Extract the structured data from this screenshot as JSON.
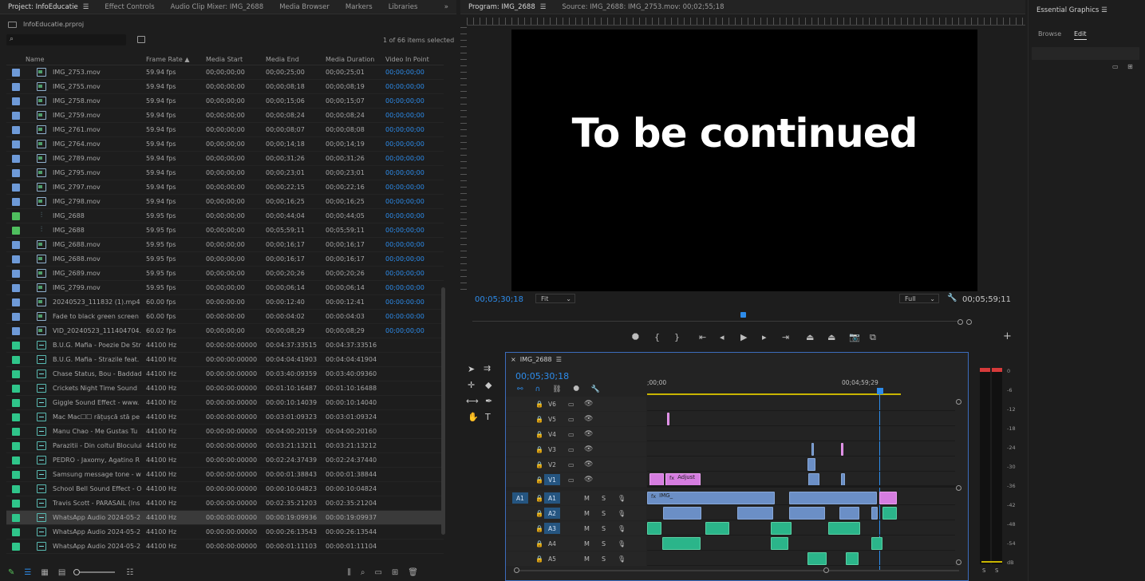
{
  "project_tabs": [
    {
      "label": "Project: InfoEducatie",
      "active": true
    },
    {
      "label": "Effect Controls"
    },
    {
      "label": "Audio Clip Mixer: IMG_2688"
    },
    {
      "label": "Media Browser"
    },
    {
      "label": "Markers"
    },
    {
      "label": "Libraries"
    }
  ],
  "project_file": "InfoEducatie.prproj",
  "search_placeholder": "",
  "items_selected": "1 of 66 items selected",
  "columns": [
    "Name",
    "Frame Rate",
    "Media Start",
    "Media End",
    "Media Duration",
    "Video In Point"
  ],
  "rows": [
    {
      "name": "IMG_2753.mov",
      "fr": "59.94 fps",
      "start": "00;00;00;00",
      "end": "00;00;25;00",
      "dur": "00;00;25;01",
      "vin": "00;00;00;00",
      "color": "#6e9ad8",
      "kind": "video"
    },
    {
      "name": "IMG_2755.mov",
      "fr": "59.94 fps",
      "start": "00;00;00;00",
      "end": "00;00;08;18",
      "dur": "00;00;08;19",
      "vin": "00;00;00;00",
      "color": "#6e9ad8",
      "kind": "video"
    },
    {
      "name": "IMG_2758.mov",
      "fr": "59.94 fps",
      "start": "00;00;00;00",
      "end": "00;00;15;06",
      "dur": "00;00;15;07",
      "vin": "00;00;00;00",
      "color": "#6e9ad8",
      "kind": "video"
    },
    {
      "name": "IMG_2759.mov",
      "fr": "59.94 fps",
      "start": "00;00;00;00",
      "end": "00;00;08;24",
      "dur": "00;00;08;24",
      "vin": "00;00;00;00",
      "color": "#6e9ad8",
      "kind": "video"
    },
    {
      "name": "IMG_2761.mov",
      "fr": "59.94 fps",
      "start": "00;00;00;00",
      "end": "00;00;08;07",
      "dur": "00;00;08;08",
      "vin": "00;00;00;00",
      "color": "#6e9ad8",
      "kind": "video"
    },
    {
      "name": "IMG_2764.mov",
      "fr": "59.94 fps",
      "start": "00;00;00;00",
      "end": "00;00;14;18",
      "dur": "00;00;14;19",
      "vin": "00;00;00;00",
      "color": "#6e9ad8",
      "kind": "video"
    },
    {
      "name": "IMG_2789.mov",
      "fr": "59.94 fps",
      "start": "00;00;00;00",
      "end": "00;00;31;26",
      "dur": "00;00;31;26",
      "vin": "00;00;00;00",
      "color": "#6e9ad8",
      "kind": "video"
    },
    {
      "name": "IMG_2795.mov",
      "fr": "59.94 fps",
      "start": "00;00;00;00",
      "end": "00;00;23;01",
      "dur": "00;00;23;01",
      "vin": "00;00;00;00",
      "color": "#6e9ad8",
      "kind": "video"
    },
    {
      "name": "IMG_2797.mov",
      "fr": "59.94 fps",
      "start": "00;00;00;00",
      "end": "00;00;22;15",
      "dur": "00;00;22;16",
      "vin": "00;00;00;00",
      "color": "#6e9ad8",
      "kind": "video"
    },
    {
      "name": "IMG_2798.mov",
      "fr": "59.94 fps",
      "start": "00;00;00;00",
      "end": "00;00;16;25",
      "dur": "00;00;16;25",
      "vin": "00;00;00;00",
      "color": "#6e9ad8",
      "kind": "video"
    },
    {
      "name": "IMG_2688",
      "fr": "59.95 fps",
      "start": "00;00;00;00",
      "end": "00;00;44;04",
      "dur": "00;00;44;05",
      "vin": "00;00;00;00",
      "color": "#4fbf5e",
      "kind": "seq"
    },
    {
      "name": "IMG_2688",
      "fr": "59.95 fps",
      "start": "00;00;00;00",
      "end": "00;05;59;11",
      "dur": "00;05;59;11",
      "vin": "00;00;00;00",
      "color": "#4fbf5e",
      "kind": "seq"
    },
    {
      "name": "IMG_2688.mov",
      "fr": "59.95 fps",
      "start": "00;00;00;00",
      "end": "00;00;16;17",
      "dur": "00;00;16;17",
      "vin": "00;00;00;00",
      "color": "#6e9ad8",
      "kind": "video"
    },
    {
      "name": "IMG_2688.mov",
      "fr": "59.95 fps",
      "start": "00;00;00;00",
      "end": "00;00;16;17",
      "dur": "00;00;16;17",
      "vin": "00;00;00;00",
      "color": "#6e9ad8",
      "kind": "video"
    },
    {
      "name": "IMG_2689.mov",
      "fr": "59.95 fps",
      "start": "00;00;00;00",
      "end": "00;00;20;26",
      "dur": "00;00;20;26",
      "vin": "00;00;00;00",
      "color": "#6e9ad8",
      "kind": "video"
    },
    {
      "name": "IMG_2799.mov",
      "fr": "59.95 fps",
      "start": "00;00;00;00",
      "end": "00;00;06;14",
      "dur": "00;00;06;14",
      "vin": "00;00;00;00",
      "color": "#6e9ad8",
      "kind": "video"
    },
    {
      "name": "20240523_111832 (1).mp4",
      "fr": "60.00 fps",
      "start": "00:00:00:00",
      "end": "00:00:12:40",
      "dur": "00:00:12:41",
      "vin": "00:00:00:00",
      "color": "#6e9ad8",
      "kind": "video"
    },
    {
      "name": "Fade to black green screen",
      "fr": "60.00 fps",
      "start": "00:00:00:00",
      "end": "00:00:04:02",
      "dur": "00:00:04:03",
      "vin": "00:00:00:00",
      "color": "#6e9ad8",
      "kind": "video"
    },
    {
      "name": "VID_20240523_111404704.",
      "fr": "60.02 fps",
      "start": "00;00;00;00",
      "end": "00;00;08;29",
      "dur": "00;00;08;29",
      "vin": "00;00;00;00",
      "color": "#6e9ad8",
      "kind": "video"
    },
    {
      "name": "B.U.G. Mafia - Poezie De Str",
      "fr": "44100 Hz",
      "start": "00:00:00:00000",
      "end": "00:04:37:33515",
      "dur": "00:04:37:33516",
      "vin": "",
      "color": "#2fc58a",
      "kind": "audio"
    },
    {
      "name": "B.U.G. Mafia - Strazile feat.",
      "fr": "44100 Hz",
      "start": "00:00:00:00000",
      "end": "00:04:04:41903",
      "dur": "00:04:04:41904",
      "vin": "",
      "color": "#2fc58a",
      "kind": "audio"
    },
    {
      "name": "Chase  Status, Bou - Baddad",
      "fr": "44100 Hz",
      "start": "00:00:00:00000",
      "end": "00:03:40:09359",
      "dur": "00:03:40:09360",
      "vin": "",
      "color": "#2fc58a",
      "kind": "audio"
    },
    {
      "name": "Crickets Night Time Sound",
      "fr": "44100 Hz",
      "start": "00:00:00:00000",
      "end": "00:01:10:16487",
      "dur": "00:01:10:16488",
      "vin": "",
      "color": "#2fc58a",
      "kind": "audio"
    },
    {
      "name": "Giggle Sound Effect - www.",
      "fr": "44100 Hz",
      "start": "00:00:00:00000",
      "end": "00:00:10:14039",
      "dur": "00:00:10:14040",
      "vin": "",
      "color": "#2fc58a",
      "kind": "audio"
    },
    {
      "name": "Mac Mac☐☐ rățușcă stă pe",
      "fr": "44100 Hz",
      "start": "00:00:00:00000",
      "end": "00:03:01:09323",
      "dur": "00:03:01:09324",
      "vin": "",
      "color": "#2fc58a",
      "kind": "audio"
    },
    {
      "name": "Manu Chao - Me Gustas Tu",
      "fr": "44100 Hz",
      "start": "00:00:00:00000",
      "end": "00:04:00:20159",
      "dur": "00:04:00:20160",
      "vin": "",
      "color": "#2fc58a",
      "kind": "audio"
    },
    {
      "name": "Parazitii - Din coltul Blocului",
      "fr": "44100 Hz",
      "start": "00:00:00:00000",
      "end": "00:03:21:13211",
      "dur": "00:03:21:13212",
      "vin": "",
      "color": "#2fc58a",
      "kind": "audio"
    },
    {
      "name": "PEDRO - Jaxomy, Agatino R",
      "fr": "44100 Hz",
      "start": "00:00:00:00000",
      "end": "00:02:24:37439",
      "dur": "00:02:24:37440",
      "vin": "",
      "color": "#2fc58a",
      "kind": "audio"
    },
    {
      "name": "Samsung message tone - w",
      "fr": "44100 Hz",
      "start": "00:00:00:00000",
      "end": "00:00:01:38843",
      "dur": "00:00:01:38844",
      "vin": "",
      "color": "#2fc58a",
      "kind": "audio"
    },
    {
      "name": "School Bell Sound Effect - O",
      "fr": "44100 Hz",
      "start": "00:00:00:00000",
      "end": "00:00:10:04823",
      "dur": "00:00:10:04824",
      "vin": "",
      "color": "#2fc58a",
      "kind": "audio"
    },
    {
      "name": "Travis Scott - PARASAIL (Ins",
      "fr": "44100 Hz",
      "start": "00:00:00:00000",
      "end": "00:02:35:21203",
      "dur": "00:02:35:21204",
      "vin": "",
      "color": "#2fc58a",
      "kind": "audio"
    },
    {
      "name": "WhatsApp Audio 2024-05-2",
      "fr": "44100 Hz",
      "start": "00:00:00:00000",
      "end": "00:00:19:09936",
      "dur": "00:00:19:09937",
      "vin": "",
      "color": "#2fc58a",
      "kind": "audio",
      "selected": true
    },
    {
      "name": "WhatsApp Audio 2024-05-2",
      "fr": "44100 Hz",
      "start": "00:00:00:00000",
      "end": "00:00:26:13543",
      "dur": "00:00:26:13544",
      "vin": "",
      "color": "#2fc58a",
      "kind": "audio"
    },
    {
      "name": "WhatsApp Audio 2024-05-2",
      "fr": "44100 Hz",
      "start": "00:00:00:00000",
      "end": "00:00:01:11103",
      "dur": "00:00:01:11104",
      "vin": "",
      "color": "#2fc58a",
      "kind": "audio"
    }
  ],
  "program": {
    "tab_label": "Program: IMG_2688",
    "source_label": "Source: IMG_2688: IMG_2753.mov: 00;02;55;18",
    "overlay_text": "To be continued",
    "current_time": "00;05;30;18",
    "fit": "Fit",
    "quality": "Full",
    "duration": "00;05;59;11"
  },
  "essential_graphics": {
    "title": "Essential Graphics",
    "tabs": [
      "Browse",
      "Edit"
    ],
    "active": "Edit"
  },
  "timeline": {
    "sequence": "IMG_2688",
    "timecode": "00;05;30;18",
    "ruler_start": ";00;00",
    "ruler_mid": "00;04;59;29",
    "video_tracks": [
      "V6",
      "V5",
      "V4",
      "V3",
      "V2",
      "V1"
    ],
    "audio_tracks": [
      "A1",
      "A2",
      "A3",
      "A4",
      "A5"
    ],
    "source_patch": "A1",
    "clip_adjust": "Adjust",
    "clip_img": "IMG_",
    "fx": "fx",
    "mute": "M",
    "solo": "S"
  },
  "meter": {
    "scale": [
      "0",
      "-6",
      "-12",
      "-18",
      "-24",
      "-30",
      "-36",
      "-42",
      "-48",
      "-54",
      "dB"
    ],
    "solo": [
      "S",
      "S"
    ]
  },
  "colors": {
    "accent": "#2d8ceb",
    "video_label": "#6e9ad8",
    "sequence_label": "#4fbf5e",
    "audio_label": "#2fc58a",
    "clip_video": "#6b8fc6",
    "clip_audio": "#2bb58a",
    "clip_adjust": "#d67de0"
  }
}
